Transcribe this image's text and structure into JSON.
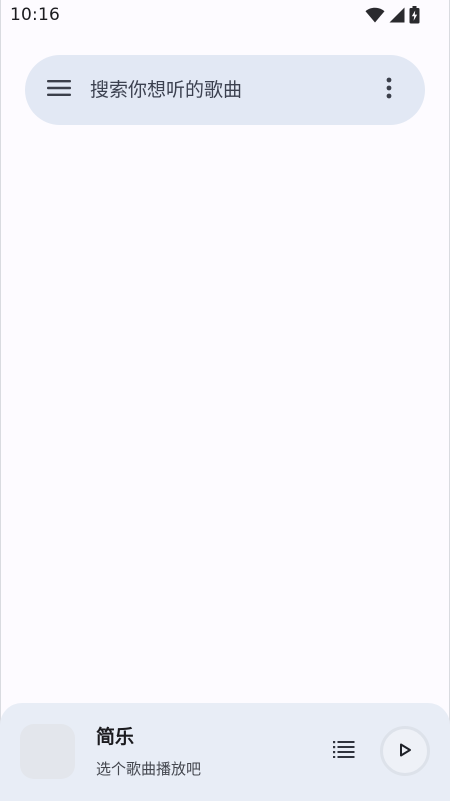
{
  "status_bar": {
    "time": "10:16",
    "icons": [
      "wifi-icon",
      "cell-signal-icon",
      "battery-charging-icon"
    ]
  },
  "search": {
    "placeholder": "搜索你想听的歌曲",
    "left_icon": "menu-icon",
    "right_icon": "more-vert-icon"
  },
  "player": {
    "title": "简乐",
    "subtitle": "选个歌曲播放吧",
    "playlist_icon": "playlist-icon",
    "play_icon": "play-icon"
  },
  "colors": {
    "background": "#fdfbff",
    "search_bar": "#e2e8f4",
    "player_bar": "#e8edf6"
  }
}
